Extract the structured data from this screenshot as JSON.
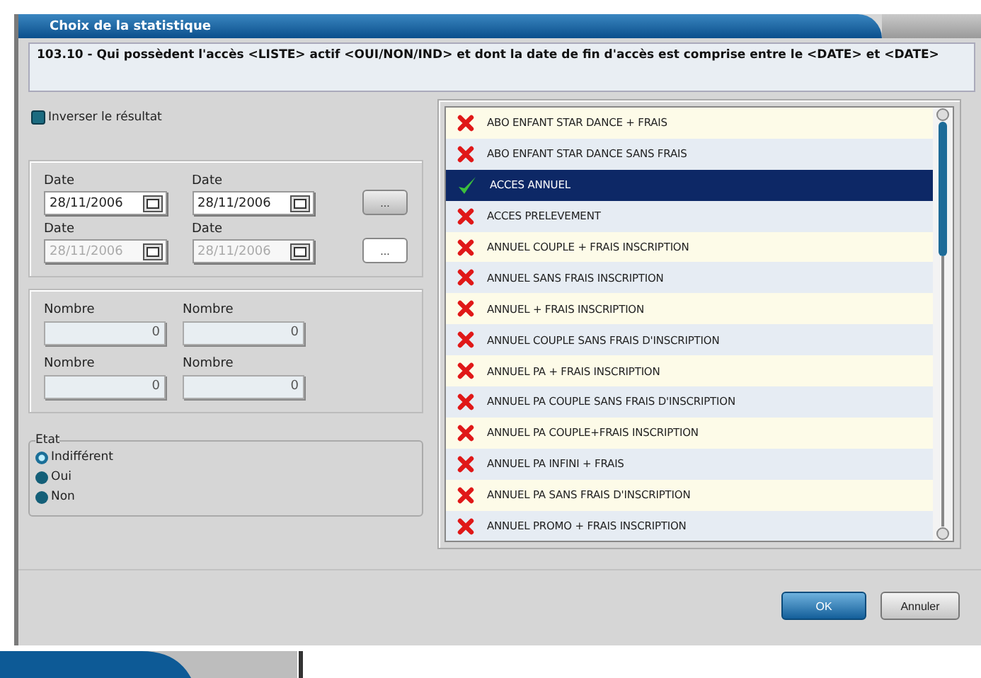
{
  "window": {
    "title": "Choix de la statistique"
  },
  "description": "103.10 - Qui possèdent l'accès <LISTE> actif <OUI/NON/IND> et dont la date de fin d'accès est comprise entre le <DATE> et <DATE>",
  "invert": {
    "label": "Inverser le résultat",
    "checked": false
  },
  "date_rows": [
    {
      "disabled": false,
      "button": "...",
      "dates": [
        {
          "label": "Date",
          "value": "28/11/2006"
        },
        {
          "label": "Date",
          "value": "28/11/2006"
        }
      ]
    },
    {
      "disabled": true,
      "button": "...",
      "dates": [
        {
          "label": "Date",
          "value": "28/11/2006"
        },
        {
          "label": "Date",
          "value": "28/11/2006"
        }
      ]
    }
  ],
  "number_rows": [
    {
      "disabled": true,
      "fields": [
        {
          "label": "Nombre",
          "value": "0"
        },
        {
          "label": "Nombre",
          "value": "0"
        }
      ]
    },
    {
      "disabled": true,
      "fields": [
        {
          "label": "Nombre",
          "value": "0"
        },
        {
          "label": "Nombre",
          "value": "0"
        }
      ]
    }
  ],
  "etat": {
    "label": "Etat",
    "options": [
      {
        "label": "Indifférent",
        "selected": true
      },
      {
        "label": "Oui",
        "selected": false
      },
      {
        "label": "Non",
        "selected": false
      }
    ]
  },
  "list": [
    {
      "label": "ABO ENFANT STAR DANCE + FRAIS",
      "checked": false,
      "selected": false
    },
    {
      "label": "ABO ENFANT STAR DANCE SANS FRAIS",
      "checked": false,
      "selected": false
    },
    {
      "label": "ACCES ANNUEL",
      "checked": true,
      "selected": true
    },
    {
      "label": "ACCES PRELEVEMENT",
      "checked": false,
      "selected": false
    },
    {
      "label": "ANNUEL  COUPLE + FRAIS INSCRIPTION",
      "checked": false,
      "selected": false
    },
    {
      "label": "ANNUEL  SANS FRAIS INSCRIPTION",
      "checked": false,
      "selected": false
    },
    {
      "label": "ANNUEL + FRAIS INSCRIPTION",
      "checked": false,
      "selected": false
    },
    {
      "label": "ANNUEL COUPLE SANS FRAIS D'INSCRIPTION",
      "checked": false,
      "selected": false
    },
    {
      "label": "ANNUEL PA + FRAIS INSCRIPTION",
      "checked": false,
      "selected": false
    },
    {
      "label": "ANNUEL PA COUPLE SANS FRAIS D'INSCRIPTION",
      "checked": false,
      "selected": false
    },
    {
      "label": "ANNUEL PA COUPLE+FRAIS INSCRIPTION",
      "checked": false,
      "selected": false
    },
    {
      "label": "ANNUEL PA INFINI + FRAIS",
      "checked": false,
      "selected": false
    },
    {
      "label": "ANNUEL PA SANS FRAIS D'INSCRIPTION",
      "checked": false,
      "selected": false
    },
    {
      "label": "ANNUEL PROMO + FRAIS INSCRIPTION",
      "checked": false,
      "selected": false
    }
  ],
  "buttons": [
    {
      "label": "OK",
      "kind": "primary"
    },
    {
      "label": "Annuler",
      "kind": "secondary"
    }
  ]
}
